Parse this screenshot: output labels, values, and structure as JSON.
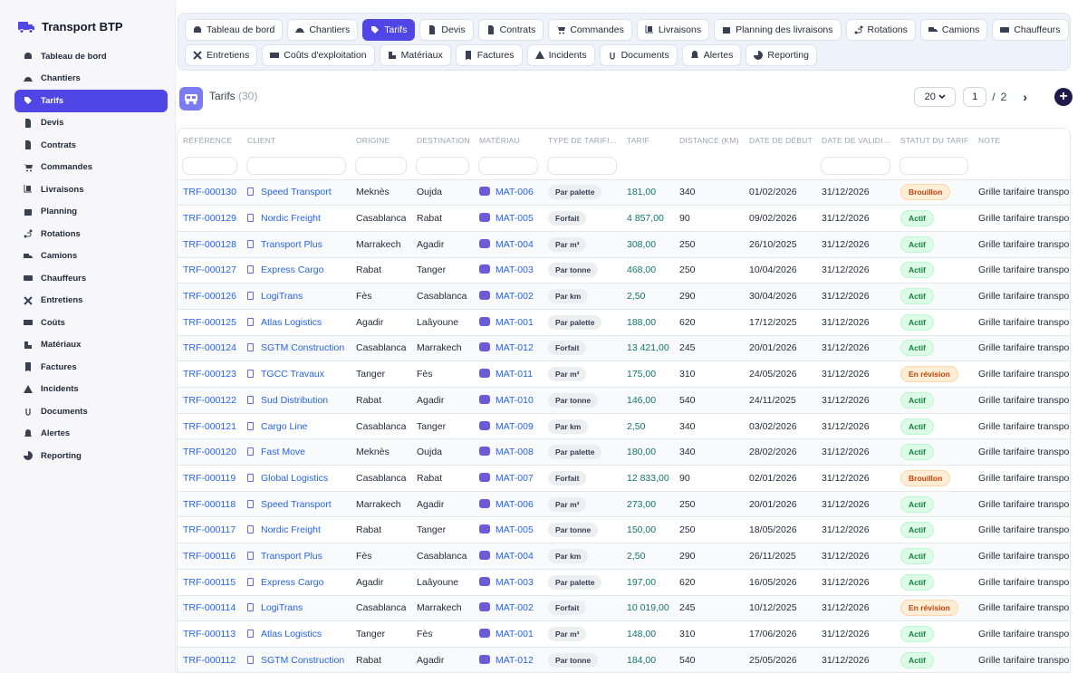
{
  "app": {
    "title": "Transport BTP"
  },
  "sidebar": {
    "items": [
      {
        "label": "Tableau de bord",
        "icon": "dashboard-icon"
      },
      {
        "label": "Chantiers",
        "icon": "helmet-icon"
      },
      {
        "label": "Tarifs",
        "icon": "tag-icon",
        "active": true
      },
      {
        "label": "Devis",
        "icon": "file-icon"
      },
      {
        "label": "Contrats",
        "icon": "file-icon"
      },
      {
        "label": "Commandes",
        "icon": "cart-icon"
      },
      {
        "label": "Livraisons",
        "icon": "dolly-icon"
      },
      {
        "label": "Planning",
        "icon": "calendar-icon"
      },
      {
        "label": "Rotations",
        "icon": "route-icon"
      },
      {
        "label": "Camions",
        "icon": "truck-icon"
      },
      {
        "label": "Chauffeurs",
        "icon": "id-card-icon"
      },
      {
        "label": "Entretiens",
        "icon": "tools-icon"
      },
      {
        "label": "Coûts",
        "icon": "money-icon"
      },
      {
        "label": "Matériaux",
        "icon": "cubes-icon"
      },
      {
        "label": "Factures",
        "icon": "invoice-icon"
      },
      {
        "label": "Incidents",
        "icon": "warning-icon"
      },
      {
        "label": "Documents",
        "icon": "paperclip-icon"
      },
      {
        "label": "Alertes",
        "icon": "bell-icon"
      },
      {
        "label": "Reporting",
        "icon": "pie-chart-icon"
      }
    ]
  },
  "tabs": {
    "row1": [
      {
        "label": "Tableau de bord"
      },
      {
        "label": "Chantiers"
      },
      {
        "label": "Tarifs",
        "active": true
      },
      {
        "label": "Devis"
      },
      {
        "label": "Contrats"
      },
      {
        "label": "Commandes"
      },
      {
        "label": "Livraisons"
      },
      {
        "label": "Planning des livraisons"
      },
      {
        "label": "Rotations"
      },
      {
        "label": "Camions"
      },
      {
        "label": "Chauffeurs"
      }
    ],
    "row2": [
      {
        "label": "Entretiens"
      },
      {
        "label": "Coûts d'exploitation"
      },
      {
        "label": "Matériaux"
      },
      {
        "label": "Factures"
      },
      {
        "label": "Incidents"
      },
      {
        "label": "Documents"
      },
      {
        "label": "Alertes"
      },
      {
        "label": "Reporting"
      }
    ]
  },
  "page": {
    "title": "Tarifs",
    "count": "(30)"
  },
  "pager": {
    "page_size": "20",
    "current": "1",
    "separator": "/",
    "total": "2",
    "next": "›",
    "add": "+"
  },
  "table": {
    "headers": [
      "Référence",
      "Client",
      "Origine",
      "Destination",
      "Matériau",
      "Type de tarifi…",
      "Tarif",
      "Distance (km)",
      "Date de début",
      "Date de validi…",
      "Statut du tarif",
      "Note"
    ],
    "rows": [
      {
        "ref": "TRF-000130",
        "client": "Speed Transport",
        "origine": "Meknès",
        "destination": "Oujda",
        "materiau": "MAT-006",
        "type": "Par palette",
        "tarif": "181,00",
        "distance": "340",
        "debut": "01/02/2026",
        "validite": "31/12/2026",
        "statut": "Brouillon",
        "note": "Grille tarifaire transport"
      },
      {
        "ref": "TRF-000129",
        "client": "Nordic Freight",
        "origine": "Casablanca",
        "destination": "Rabat",
        "materiau": "MAT-005",
        "type": "Forfait",
        "tarif": "4 857,00",
        "distance": "90",
        "debut": "09/02/2026",
        "validite": "31/12/2026",
        "statut": "Actif",
        "note": "Grille tarifaire transport"
      },
      {
        "ref": "TRF-000128",
        "client": "Transport Plus",
        "origine": "Marrakech",
        "destination": "Agadir",
        "materiau": "MAT-004",
        "type": "Par m³",
        "tarif": "308,00",
        "distance": "250",
        "debut": "26/10/2025",
        "validite": "31/12/2026",
        "statut": "Actif",
        "note": "Grille tarifaire transport"
      },
      {
        "ref": "TRF-000127",
        "client": "Express Cargo",
        "origine": "Rabat",
        "destination": "Tanger",
        "materiau": "MAT-003",
        "type": "Par tonne",
        "tarif": "468,00",
        "distance": "250",
        "debut": "10/04/2026",
        "validite": "31/12/2026",
        "statut": "Actif",
        "note": "Grille tarifaire transport"
      },
      {
        "ref": "TRF-000126",
        "client": "LogiTrans",
        "origine": "Fès",
        "destination": "Casablanca",
        "materiau": "MAT-002",
        "type": "Par km",
        "tarif": "2,50",
        "distance": "290",
        "debut": "30/04/2026",
        "validite": "31/12/2026",
        "statut": "Actif",
        "note": "Grille tarifaire transport"
      },
      {
        "ref": "TRF-000125",
        "client": "Atlas Logistics",
        "origine": "Agadir",
        "destination": "Laâyoune",
        "materiau": "MAT-001",
        "type": "Par palette",
        "tarif": "188,00",
        "distance": "620",
        "debut": "17/12/2025",
        "validite": "31/12/2026",
        "statut": "Actif",
        "note": "Grille tarifaire transport"
      },
      {
        "ref": "TRF-000124",
        "client": "SGTM Construction",
        "origine": "Casablanca",
        "destination": "Marrakech",
        "materiau": "MAT-012",
        "type": "Forfait",
        "tarif": "13 421,00",
        "distance": "245",
        "debut": "20/01/2026",
        "validite": "31/12/2026",
        "statut": "Actif",
        "note": "Grille tarifaire transport"
      },
      {
        "ref": "TRF-000123",
        "client": "TGCC Travaux",
        "origine": "Tanger",
        "destination": "Fès",
        "materiau": "MAT-011",
        "type": "Par m³",
        "tarif": "175,00",
        "distance": "310",
        "debut": "24/05/2026",
        "validite": "31/12/2026",
        "statut": "En révision",
        "note": "Grille tarifaire transport"
      },
      {
        "ref": "TRF-000122",
        "client": "Sud Distribution",
        "origine": "Rabat",
        "destination": "Agadir",
        "materiau": "MAT-010",
        "type": "Par tonne",
        "tarif": "146,00",
        "distance": "540",
        "debut": "24/11/2025",
        "validite": "31/12/2026",
        "statut": "Actif",
        "note": "Grille tarifaire transport"
      },
      {
        "ref": "TRF-000121",
        "client": "Cargo Line",
        "origine": "Casablanca",
        "destination": "Tanger",
        "materiau": "MAT-009",
        "type": "Par km",
        "tarif": "2,50",
        "distance": "340",
        "debut": "03/02/2026",
        "validite": "31/12/2026",
        "statut": "Actif",
        "note": "Grille tarifaire transport"
      },
      {
        "ref": "TRF-000120",
        "client": "Fast Move",
        "origine": "Meknès",
        "destination": "Oujda",
        "materiau": "MAT-008",
        "type": "Par palette",
        "tarif": "180,00",
        "distance": "340",
        "debut": "28/02/2026",
        "validite": "31/12/2026",
        "statut": "Actif",
        "note": "Grille tarifaire transport"
      },
      {
        "ref": "TRF-000119",
        "client": "Global Logistics",
        "origine": "Casablanca",
        "destination": "Rabat",
        "materiau": "MAT-007",
        "type": "Forfait",
        "tarif": "12 833,00",
        "distance": "90",
        "debut": "02/01/2026",
        "validite": "31/12/2026",
        "statut": "Brouillon",
        "note": "Grille tarifaire transport"
      },
      {
        "ref": "TRF-000118",
        "client": "Speed Transport",
        "origine": "Marrakech",
        "destination": "Agadir",
        "materiau": "MAT-006",
        "type": "Par m³",
        "tarif": "273,00",
        "distance": "250",
        "debut": "20/01/2026",
        "validite": "31/12/2026",
        "statut": "Actif",
        "note": "Grille tarifaire transport"
      },
      {
        "ref": "TRF-000117",
        "client": "Nordic Freight",
        "origine": "Rabat",
        "destination": "Tanger",
        "materiau": "MAT-005",
        "type": "Par tonne",
        "tarif": "150,00",
        "distance": "250",
        "debut": "18/05/2026",
        "validite": "31/12/2026",
        "statut": "Actif",
        "note": "Grille tarifaire transport"
      },
      {
        "ref": "TRF-000116",
        "client": "Transport Plus",
        "origine": "Fès",
        "destination": "Casablanca",
        "materiau": "MAT-004",
        "type": "Par km",
        "tarif": "2,50",
        "distance": "290",
        "debut": "26/11/2025",
        "validite": "31/12/2026",
        "statut": "Actif",
        "note": "Grille tarifaire transport"
      },
      {
        "ref": "TRF-000115",
        "client": "Express Cargo",
        "origine": "Agadir",
        "destination": "Laâyoune",
        "materiau": "MAT-003",
        "type": "Par palette",
        "tarif": "197,00",
        "distance": "620",
        "debut": "16/05/2026",
        "validite": "31/12/2026",
        "statut": "Actif",
        "note": "Grille tarifaire transport"
      },
      {
        "ref": "TRF-000114",
        "client": "LogiTrans",
        "origine": "Casablanca",
        "destination": "Marrakech",
        "materiau": "MAT-002",
        "type": "Forfait",
        "tarif": "10 019,00",
        "distance": "245",
        "debut": "10/12/2025",
        "validite": "31/12/2026",
        "statut": "En révision",
        "note": "Grille tarifaire transport"
      },
      {
        "ref": "TRF-000113",
        "client": "Atlas Logistics",
        "origine": "Tanger",
        "destination": "Fès",
        "materiau": "MAT-001",
        "type": "Par m³",
        "tarif": "148,00",
        "distance": "310",
        "debut": "17/06/2026",
        "validite": "31/12/2026",
        "statut": "Actif",
        "note": "Grille tarifaire transport"
      },
      {
        "ref": "TRF-000112",
        "client": "SGTM Construction",
        "origine": "Rabat",
        "destination": "Agadir",
        "materiau": "MAT-012",
        "type": "Par tonne",
        "tarif": "184,00",
        "distance": "540",
        "debut": "25/05/2026",
        "validite": "31/12/2026",
        "statut": "Actif",
        "note": "Grille tarifaire transport"
      }
    ]
  },
  "colors": {
    "accent": "#4f46e5",
    "link": "#2563eb",
    "tarif": "#0f766e",
    "actif": "#15803d",
    "brouillon": "#c2410c",
    "revision": "#c2410c"
  }
}
